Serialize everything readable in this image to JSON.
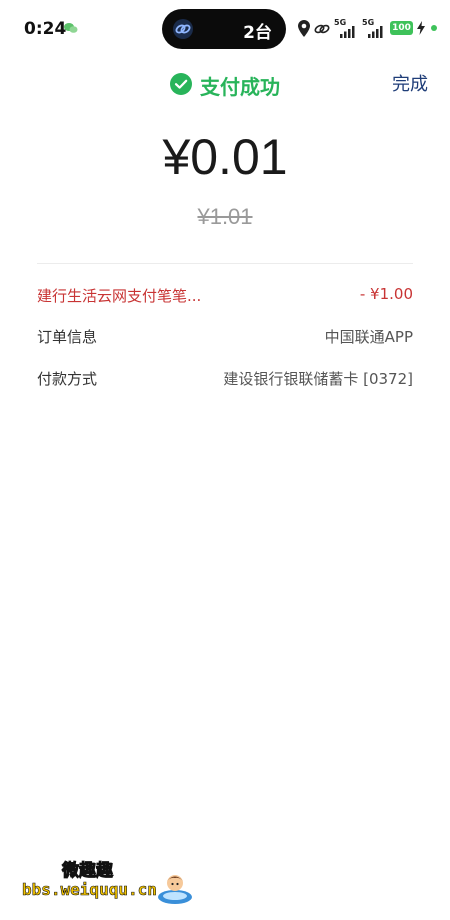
{
  "status_bar": {
    "time": "0:24",
    "island_text": "2台",
    "signal_1_label": "5G",
    "signal_2_label": "5G",
    "battery": "100"
  },
  "header": {
    "status_text": "支付成功",
    "done_label": "完成"
  },
  "amounts": {
    "paid": "¥0.01",
    "original": "¥1.01"
  },
  "details": {
    "discount": {
      "label": "建行生活云网支付笔笔...",
      "value": "- ¥1.00"
    },
    "order": {
      "label": "订单信息",
      "value": "中国联通APP"
    },
    "payment": {
      "label": "付款方式",
      "value": "建设银行银联储蓄卡 [0372]"
    }
  },
  "watermark": {
    "top": "微趣趣",
    "bottom": "bbs.weiququ.cn"
  },
  "colors": {
    "success_green": "#28b45a",
    "done_blue": "#1f3d78",
    "discount_red": "#c83434"
  }
}
